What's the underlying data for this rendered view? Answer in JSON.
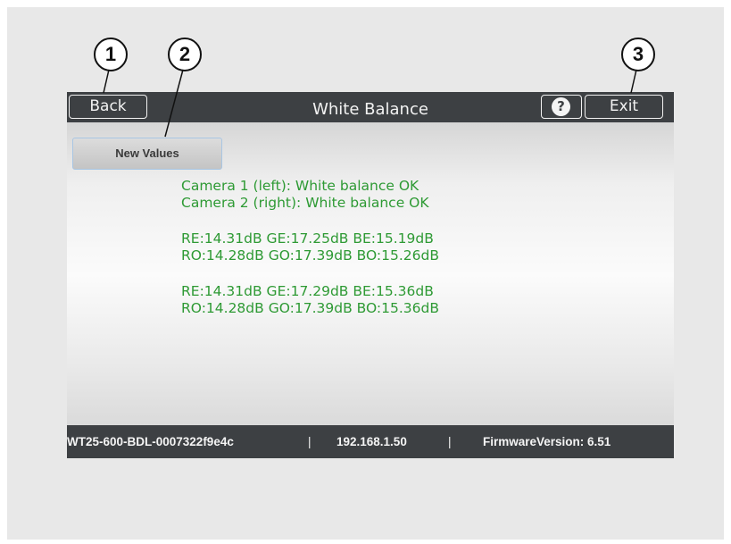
{
  "callouts": [
    "1",
    "2",
    "3"
  ],
  "header": {
    "back_label": "Back",
    "title": "White Balance",
    "help_label": "?",
    "exit_label": "Exit"
  },
  "main": {
    "new_values_label": "New Values",
    "camera1_status": "Camera 1 (left): White balance OK",
    "camera2_status": "Camera 2 (right): White balance OK",
    "values_even_1": "RE:14.31dB GE:17.25dB BE:15.19dB",
    "values_odd_1": "RO:14.28dB GO:17.39dB BO:15.26dB",
    "values_even_2": "RE:14.31dB GE:17.29dB BE:15.36dB",
    "values_odd_2": "RO:14.28dB GO:17.39dB BO:15.36dB"
  },
  "footer": {
    "device_id": "WT25-600-BDL-0007322f9e4c",
    "separator": "|",
    "ip_address": "192.168.1.50",
    "firmware": "FirmwareVersion: 6.51"
  },
  "colors": {
    "bar": "#3d4043",
    "status_text": "#2e9a34",
    "button_border": "#a9c6e3"
  }
}
